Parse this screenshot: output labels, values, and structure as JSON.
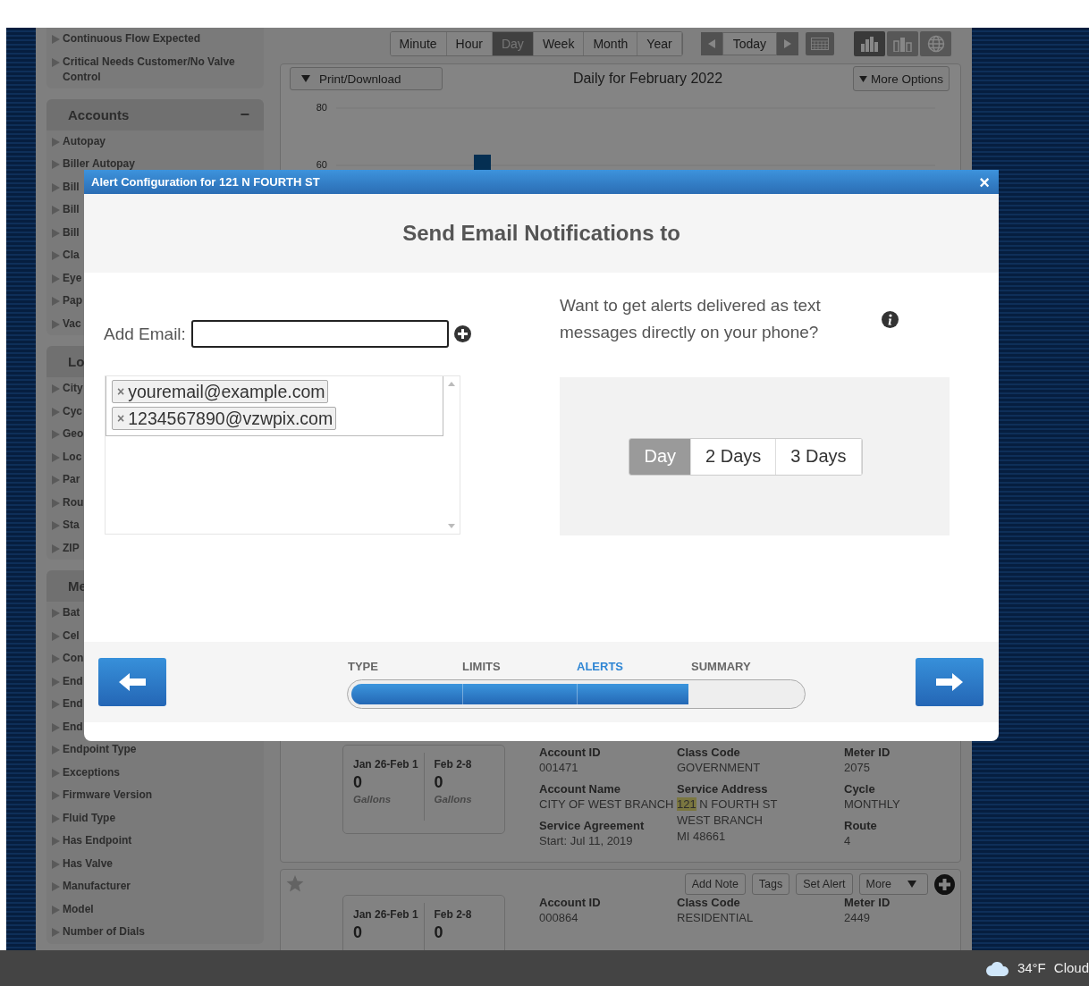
{
  "sidebar": {
    "groups": [
      {
        "items": [
          {
            "label": "Continuous Flow Expected"
          },
          {
            "label": "Critical Needs Customer/No Valve Control"
          }
        ]
      },
      {
        "title": "Accounts",
        "collapse_sign": "−",
        "items": [
          {
            "label": "Autopay"
          },
          {
            "label": "Biller Autopay"
          },
          {
            "label": "Bill"
          },
          {
            "label": "Bill"
          },
          {
            "label": "Bill"
          },
          {
            "label": "Cla"
          },
          {
            "label": "Eye"
          },
          {
            "label": "Pap"
          },
          {
            "label": "Vac"
          }
        ]
      },
      {
        "title": "Lo",
        "items": [
          {
            "label": "City"
          },
          {
            "label": "Cyc"
          },
          {
            "label": "Geo"
          },
          {
            "label": "Loc"
          },
          {
            "label": "Par"
          },
          {
            "label": "Rou"
          },
          {
            "label": "Sta"
          },
          {
            "label": "ZIP"
          }
        ]
      },
      {
        "title": "Me",
        "items": [
          {
            "label": "Bat"
          },
          {
            "label": "Cel"
          },
          {
            "label": "Con"
          },
          {
            "label": "End"
          },
          {
            "label": "End"
          },
          {
            "label": "End"
          },
          {
            "label": "Endpoint Type"
          },
          {
            "label": "Exceptions"
          },
          {
            "label": "Firmware Version"
          },
          {
            "label": "Fluid Type"
          },
          {
            "label": "Has Endpoint"
          },
          {
            "label": "Has Valve"
          },
          {
            "label": "Manufacturer"
          },
          {
            "label": "Model"
          },
          {
            "label": "Number of Dials"
          }
        ]
      }
    ]
  },
  "toolbar": {
    "periods": [
      {
        "label": "Minute",
        "selected": false
      },
      {
        "label": "Hour",
        "selected": false
      },
      {
        "label": "Day",
        "selected": true
      },
      {
        "label": "Week",
        "selected": false
      },
      {
        "label": "Month",
        "selected": false
      },
      {
        "label": "Year",
        "selected": false
      }
    ],
    "today": "Today",
    "views": [
      {
        "kind": "bars",
        "selected": true
      },
      {
        "kind": "stacked",
        "selected": false
      },
      {
        "kind": "globe",
        "selected": false
      }
    ]
  },
  "chart": {
    "print_button": "Print/Download",
    "title": "Daily for February 2022",
    "more_button": "More Options",
    "y_labels": [
      "80",
      "60"
    ]
  },
  "accounts": [
    {
      "usage": [
        {
          "period": "Jan 26-Feb 1",
          "value": "0",
          "unit": "Gallons"
        },
        {
          "period": "Feb 2-8",
          "value": "0",
          "unit": "Gallons"
        }
      ],
      "columns": [
        [
          {
            "label": "Account ID",
            "lines": [
              "001471"
            ]
          },
          {
            "label": "Account Name",
            "lines": [
              "CITY OF WEST BRANCH"
            ]
          },
          {
            "label": "Service Agreement",
            "lines": [
              "Start: Jul 11, 2019"
            ]
          }
        ],
        [
          {
            "label": "Class Code",
            "lines": [
              "GOVERNMENT"
            ]
          },
          {
            "label": "Service Address",
            "highlight": "121",
            "lines": [
              "N FOURTH ST",
              "WEST BRANCH",
              "MI 48661"
            ]
          }
        ],
        [
          {
            "label": "Meter ID",
            "lines": [
              "2075"
            ]
          },
          {
            "label": "Cycle",
            "lines": [
              "MONTHLY"
            ]
          },
          {
            "label": "Route",
            "lines": [
              "4"
            ]
          }
        ]
      ]
    },
    {
      "actions": [
        "Add Note",
        "Tags",
        "Set Alert",
        "More"
      ],
      "usage": [
        {
          "period": "Jan 26-Feb 1",
          "value": "0"
        },
        {
          "period": "Feb 2-8",
          "value": "0"
        }
      ],
      "columns": [
        [
          {
            "label": "Account ID",
            "lines": [
              "000864"
            ]
          }
        ],
        [
          {
            "label": "Class Code",
            "lines": [
              "RESIDENTIAL"
            ]
          }
        ],
        [
          {
            "label": "Meter ID",
            "lines": [
              "2449"
            ]
          }
        ]
      ]
    }
  ],
  "modal": {
    "title": "Alert Configuration for 121 N FOURTH ST",
    "close": "×",
    "heading": "Send Email Notifications to",
    "add_email_label": "Add Email:",
    "emails": [
      {
        "remove": "×",
        "address": "youremail@example.com"
      },
      {
        "remove": "×",
        "address": "1234567890@vzwpix.com"
      }
    ],
    "sms_prompt": "Want to get alerts delivered as text messages directly on your phone?",
    "delivery": [
      {
        "label": "Day",
        "selected": true
      },
      {
        "label": "2 Days",
        "selected": false
      },
      {
        "label": "3 Days",
        "selected": false
      }
    ],
    "steps": [
      {
        "label": "TYPE",
        "selected": false
      },
      {
        "label": "LIMITS",
        "selected": false
      },
      {
        "label": "ALERTS",
        "selected": true
      },
      {
        "label": "SUMMARY",
        "selected": false
      }
    ],
    "progress": {
      "level": 0.75
    }
  },
  "taskbar": {
    "temperature": "34°F",
    "condition": "Cloud"
  }
}
